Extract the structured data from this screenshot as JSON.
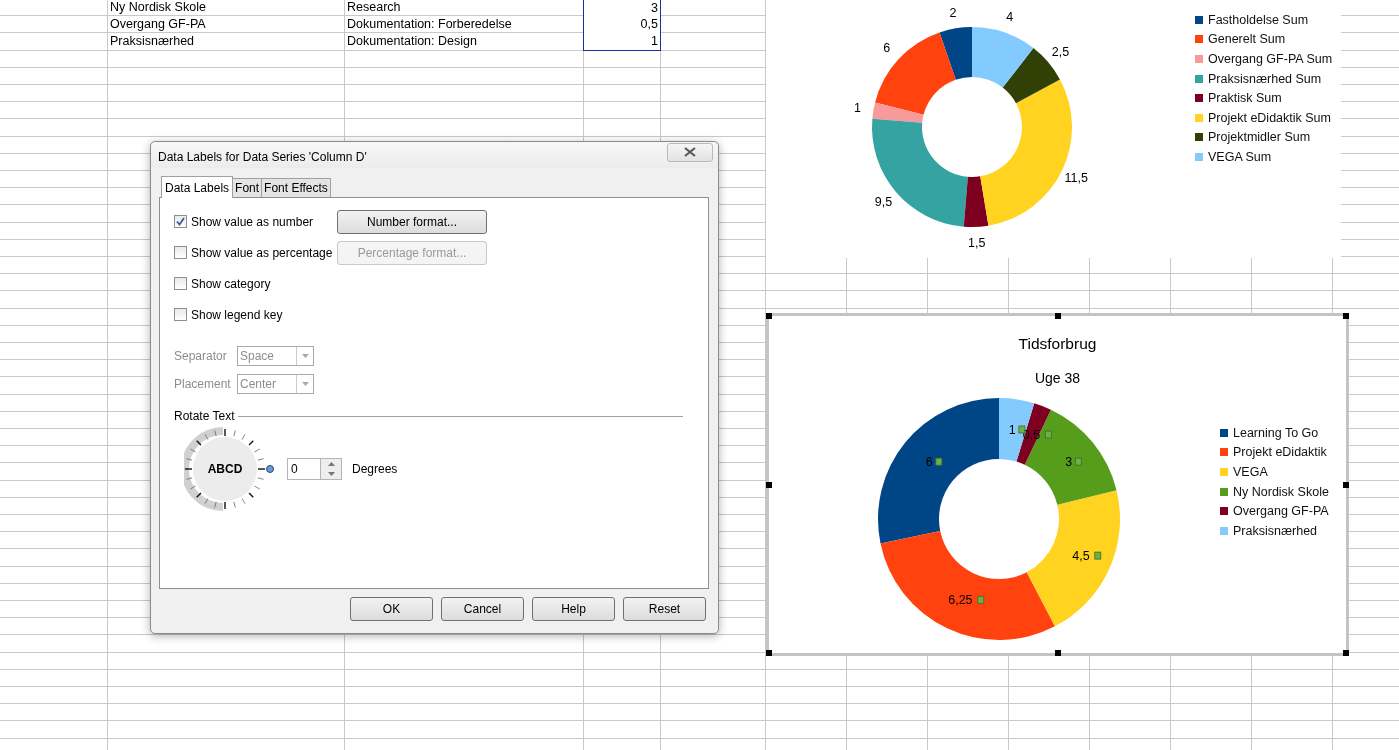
{
  "sheet": {
    "rows": [
      {
        "cells": [
          {
            "text": "Ny Nordisk Skole",
            "selected": false
          },
          {
            "text": "Research",
            "selected": false
          },
          {
            "text": "3",
            "selected": true
          }
        ]
      },
      {
        "cells": [
          {
            "text": "Overgang GF-PA",
            "selected": false
          },
          {
            "text": "Dokumentation: Forberedelse",
            "selected": false
          },
          {
            "text": "0,5",
            "selected": true
          }
        ]
      },
      {
        "cells": [
          {
            "text": "Praksisnærhed",
            "selected": false
          },
          {
            "text": "Dokumentation: Design",
            "selected": false
          },
          {
            "text": "1",
            "selected": true
          }
        ]
      }
    ]
  },
  "dialog": {
    "title": "Data Labels for Data Series 'Column D'",
    "tabs": [
      {
        "label": "Data Labels",
        "selected": true
      },
      {
        "label": "Font",
        "selected": false
      },
      {
        "label": "Font Effects",
        "selected": false
      }
    ],
    "options": [
      {
        "label": "Show value as number",
        "checked": true,
        "button": {
          "label": "Number format...",
          "disabled": false
        }
      },
      {
        "label": "Show value as percentage",
        "checked": false,
        "button": {
          "label": "Percentage format...",
          "disabled": true
        }
      },
      {
        "label": "Show category",
        "checked": false
      },
      {
        "label": "Show legend key",
        "checked": false
      }
    ],
    "selects": [
      {
        "label": "Separator",
        "value": "Space",
        "disabled": true
      },
      {
        "label": "Placement",
        "value": "Center",
        "disabled": true
      }
    ],
    "rotate": {
      "heading": "Rotate Text",
      "sample": "ABCD",
      "value": "0",
      "unit": "Degrees"
    },
    "buttons": [
      "OK",
      "Cancel",
      "Help",
      "Reset"
    ]
  },
  "charts": [
    {
      "legend_keys": [
        {
          "color": "#004586"
        },
        {
          "color": "#ff420e"
        },
        {
          "color": "#f89a9a"
        },
        {
          "color": "#36a3a3"
        },
        {
          "color": "#7e0021"
        },
        {
          "color": "#ffd320"
        },
        {
          "color": "#314004"
        },
        {
          "color": "#83caff"
        }
      ],
      "chart_data": {
        "type": "donut",
        "legend": "right",
        "categories": [
          "Fastholdelse Sum",
          "Generelt Sum",
          "Overgang GF-PA Sum",
          "Praksisnærhed Sum",
          "Praktisk Sum",
          "Projekt eDidaktik Sum",
          "Projektmidler Sum",
          "VEGA Sum"
        ],
        "values": [
          2,
          6,
          1,
          9.5,
          1.5,
          11.5,
          2.5,
          4
        ],
        "value_labels": [
          "2",
          "6",
          "1",
          "9,5",
          "1,5",
          "11,5",
          "2,5",
          "4"
        ]
      }
    },
    {
      "selected": true,
      "subtitle": "Uge 38",
      "legend_keys": [
        {
          "color": "#004586"
        },
        {
          "color": "#ff420e"
        },
        {
          "color": "#ffd320"
        },
        {
          "color": "#579d1c"
        },
        {
          "color": "#7e0021"
        },
        {
          "color": "#83caff"
        }
      ],
      "chart_data": {
        "type": "donut",
        "legend": "right",
        "title": "Tidsforbrug",
        "categories": [
          "Learning To Go",
          "Projekt eDidaktik",
          "VEGA",
          "Ny Nordisk Skole",
          "Overgang GF-PA",
          "Praksisnærhed"
        ],
        "values": [
          6,
          6.25,
          4.5,
          3,
          0.5,
          1
        ],
        "value_labels": [
          "6",
          "6,25",
          "4,5",
          "3",
          "0,5",
          "1"
        ]
      }
    }
  ]
}
